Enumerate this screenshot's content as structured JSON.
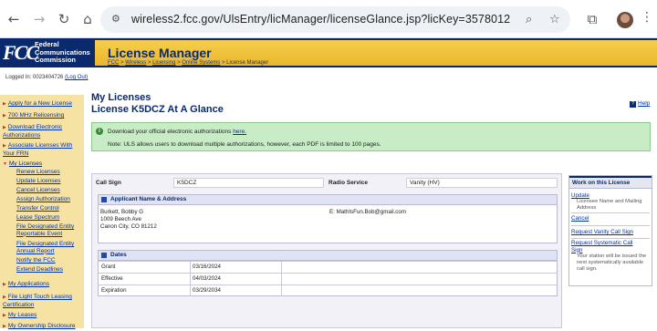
{
  "browser": {
    "url": "wireless2.fcc.gov/UlsEntry/licManager/licenseGlance.jsp?licKey=3578012"
  },
  "header": {
    "logo_mark": "FCC",
    "logo_lines": [
      "Federal",
      "Communications",
      "Commission"
    ],
    "title": "License Manager"
  },
  "breadcrumb": {
    "items": [
      "FCC",
      "Wireless",
      "Licensing",
      "Online Systems"
    ],
    "current": "License Manager",
    "separator": ">"
  },
  "login": {
    "text": "Logged In: 0023404726",
    "logout": "(Log Out)"
  },
  "sidebar": {
    "items": [
      {
        "label": "Apply for a New License"
      },
      {
        "label": "700 MHz Relicensing"
      },
      {
        "label": "Download Electronic Authorizations"
      },
      {
        "label": "Associate Licenses With Your FRN"
      },
      {
        "label": "My Licenses"
      },
      {
        "label": "Renew Licenses"
      },
      {
        "label": "Update Licenses"
      },
      {
        "label": "Cancel Licenses"
      },
      {
        "label": "Assign Authorization"
      },
      {
        "label": "Transfer Control"
      },
      {
        "label": "Lease Spectrum"
      },
      {
        "label": "File Designated Entity Reportable Event"
      },
      {
        "label": "File Designated Entity Annual Report"
      },
      {
        "label": "Notify the FCC"
      },
      {
        "label": "Extend Deadlines"
      },
      {
        "label": "My Applications"
      },
      {
        "label": "File Light Touch Leasing Certification"
      },
      {
        "label": "My Leases"
      },
      {
        "label": "My Ownership Disclosure"
      }
    ]
  },
  "page": {
    "heading1": "My Licenses",
    "heading2": "License K5DCZ At A Glance",
    "help": "Help"
  },
  "notice": {
    "line1_prefix": "Download your official electronic authorizations",
    "line1_link": "here.",
    "line2": "Note: ULS allows users to download multiple authorizations, however, each PDF is limited to 100 pages."
  },
  "license": {
    "call_sign_label": "Call Sign",
    "call_sign": "K5DCZ",
    "radio_service_label": "Radio Service",
    "radio_service": "Vanity (HV)"
  },
  "applicant": {
    "section_title": "Applicant Name & Address",
    "name": "Burkett, Bobby G",
    "address1": "1009 Beech Ave",
    "address2": "Canon City, CO 81212",
    "email": "E: MathIsFun.Bob@gmail.com"
  },
  "dates": {
    "section_title": "Dates",
    "rows": [
      {
        "label": "Grant",
        "value": "03/16/2024"
      },
      {
        "label": "Effective",
        "value": "04/03/2024"
      },
      {
        "label": "Expiration",
        "value": "03/29/2034"
      }
    ]
  },
  "work": {
    "title": "Work on this License",
    "update": "Update",
    "update_desc": "Licensee Name and Mailing Address",
    "cancel": "Cancel",
    "vanity": "Request Vanity Call Sign",
    "systematic": "Request Systematic Call Sign",
    "systematic_desc": "Your station will be issued the next systematically available call sign."
  }
}
